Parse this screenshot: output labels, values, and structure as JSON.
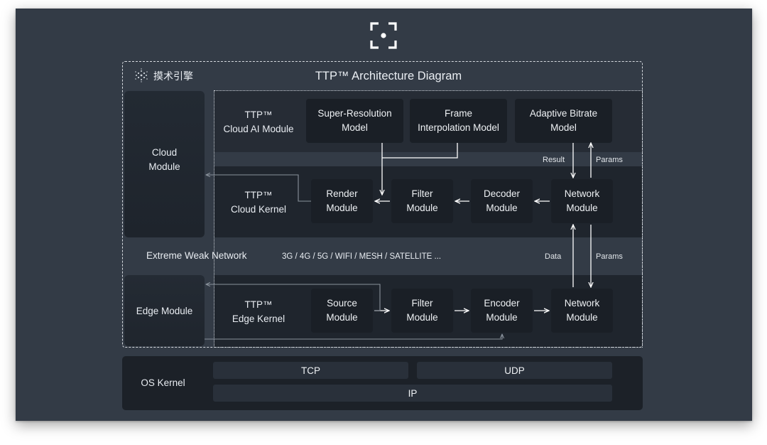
{
  "logo_text": "摸术引擎",
  "title": "TTP™ Architecture Diagram",
  "colors": {
    "background": "#333b46",
    "box": "#1a1f26",
    "os_panel": "#1c2128",
    "os_bar": "#29303a",
    "text": "#e9edf2"
  },
  "icons": {
    "top": "focus-target-icon",
    "logo": "globe-logo-icon"
  },
  "modules": {
    "cloud": "Cloud\nModule",
    "edge": "Edge Module"
  },
  "rows": {
    "ai": "TTP™\nCloud AI Module",
    "kernel": "TTP™\nCloud Kernel",
    "edge": "TTP™\nEdge Kernel"
  },
  "ai_boxes": {
    "super_resolution": "Super-Resolution\nModel",
    "frame_interpolation": "Frame\nInterpolation Model",
    "adaptive_bitrate": "Adaptive Bitrate\nModel"
  },
  "cloud_kernel_boxes": {
    "render": "Render\nModule",
    "filter": "Filter\nModule",
    "decoder": "Decoder\nModule",
    "network": "Network\nModule"
  },
  "edge_kernel_boxes": {
    "source": "Source\nModule",
    "filter": "Filter\nModule",
    "encoder": "Encoder\nModule",
    "network": "Network\nModule"
  },
  "network": {
    "label": "Extreme Weak Network",
    "types": "3G / 4G / 5G / WIFI / MESH / SATELLITE ..."
  },
  "arrow_labels": {
    "result": "Result",
    "params_top": "Params",
    "data": "Data",
    "params_mid": "Params"
  },
  "os": {
    "label": "OS Kernel",
    "tcp": "TCP",
    "udp": "UDP",
    "ip": "IP"
  }
}
